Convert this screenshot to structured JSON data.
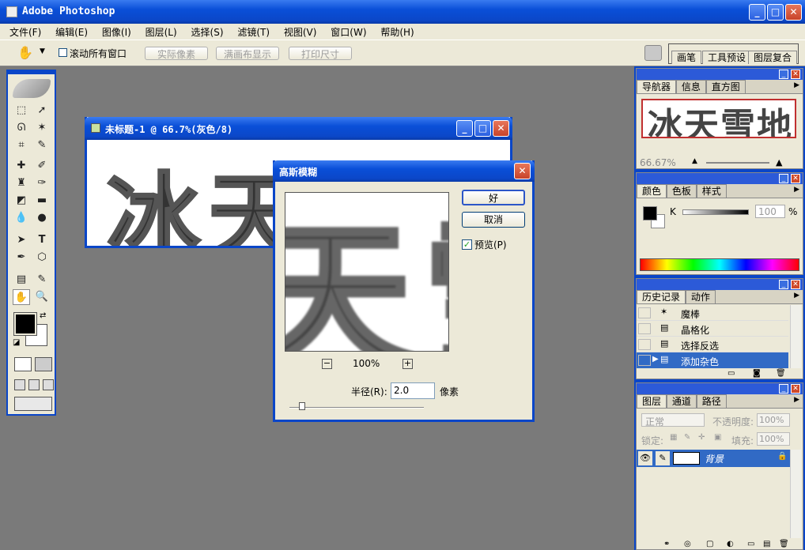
{
  "app": {
    "title": "Adobe Photoshop"
  },
  "menu": [
    "文件(F)",
    "编辑(E)",
    "图像(I)",
    "图层(L)",
    "选择(S)",
    "滤镜(T)",
    "视图(V)",
    "窗口(W)",
    "帮助(H)"
  ],
  "options": {
    "scroll_all": "滚动所有窗口",
    "actual_pixels": "实际像素",
    "fit_screen": "满画布显示",
    "print_size": "打印尺寸"
  },
  "palette_well": [
    "画笔",
    "工具预设",
    "图层复合"
  ],
  "document": {
    "title": "未标题-1 @ 66.7%(灰色/8)",
    "text": "冰天雪地"
  },
  "dialog": {
    "title": "高斯模糊",
    "ok": "好",
    "cancel": "取消",
    "preview": "预览(P)",
    "zoom": "100%",
    "radius_label": "半径(R):",
    "radius_value": "2.0",
    "unit": "像素"
  },
  "navigator": {
    "tabs": [
      "导航器",
      "信息",
      "直方图"
    ],
    "thumb_text": "冰天雪地",
    "zoom": "66.67%"
  },
  "color": {
    "tabs": [
      "颜色",
      "色板",
      "样式"
    ],
    "channel": "K",
    "value": "100",
    "unit": "%"
  },
  "history": {
    "tabs": [
      "历史记录",
      "动作"
    ],
    "items": [
      "魔棒",
      "晶格化",
      "选择反选",
      "添加杂色"
    ]
  },
  "layers": {
    "tabs": [
      "图层",
      "通道",
      "路径"
    ],
    "blend_mode": "正常",
    "opacity_label": "不透明度:",
    "opacity_value": "100%",
    "lock_label": "锁定:",
    "fill_label": "填充:",
    "fill_value": "100%",
    "layer_name": "背景"
  }
}
